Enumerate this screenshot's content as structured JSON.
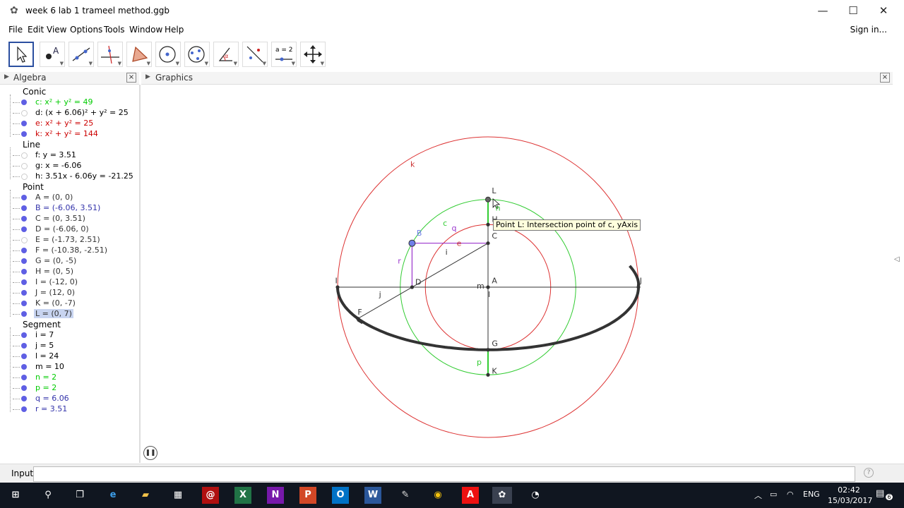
{
  "window": {
    "title": "week 6 lab 1 trameel method.ggb",
    "app_icon": "geogebra-icon"
  },
  "menu": {
    "items": [
      "File",
      "Edit",
      "View",
      "Options",
      "Tools",
      "Window",
      "Help"
    ],
    "signin": "Sign in..."
  },
  "toolbar": {
    "tools": [
      "move-tool",
      "point-tool",
      "line-tool",
      "perpendicular-tool",
      "polygon-tool",
      "circle-tool",
      "conic-tool",
      "angle-tool",
      "reflect-tool",
      "slider-tool",
      "move-graphics-tool"
    ],
    "slider_label": "a = 2"
  },
  "panels": {
    "algebra": "Algebra",
    "graphics": "Graphics"
  },
  "algebra": {
    "categories": [
      "Conic",
      "Line",
      "Point",
      "Segment"
    ],
    "conic": [
      {
        "text": "c: x² + y² = 49",
        "color": "#00cc00",
        "shown": true
      },
      {
        "text": "d: (x + 6.06)² + y² = 25",
        "color": "#000000",
        "shown": false
      },
      {
        "text": "e: x² + y² = 25",
        "color": "#cc0000",
        "shown": true
      },
      {
        "text": "k: x² + y² = 144",
        "color": "#cc0000",
        "shown": true
      }
    ],
    "line": [
      {
        "text": "f: y = 3.51",
        "color": "#000000",
        "shown": false
      },
      {
        "text": "g: x = -6.06",
        "color": "#000000",
        "shown": false
      },
      {
        "text": "h: 3.51x - 6.06y = -21.25",
        "color": "#000000",
        "shown": false
      }
    ],
    "point": [
      {
        "text": "A = (0, 0)",
        "color": "#333333",
        "shown": true
      },
      {
        "text": "B = (-6.06, 3.51)",
        "color": "#3333aa",
        "shown": true
      },
      {
        "text": "C = (0, 3.51)",
        "color": "#333333",
        "shown": true
      },
      {
        "text": "D = (-6.06, 0)",
        "color": "#333333",
        "shown": true
      },
      {
        "text": "E = (-1.73, 2.51)",
        "color": "#333333",
        "shown": false
      },
      {
        "text": "F = (-10.38, -2.51)",
        "color": "#333333",
        "shown": true
      },
      {
        "text": "G = (0, -5)",
        "color": "#333333",
        "shown": true
      },
      {
        "text": "H = (0, 5)",
        "color": "#333333",
        "shown": true
      },
      {
        "text": "I = (-12, 0)",
        "color": "#333333",
        "shown": true
      },
      {
        "text": "J = (12, 0)",
        "color": "#333333",
        "shown": true
      },
      {
        "text": "K = (0, -7)",
        "color": "#333333",
        "shown": true
      },
      {
        "text": "L = (0, 7)",
        "color": "#333333",
        "shown": true,
        "selected": true
      }
    ],
    "segment": [
      {
        "text": "i = 7",
        "color": "#000000",
        "shown": true
      },
      {
        "text": "j = 5",
        "color": "#000000",
        "shown": true
      },
      {
        "text": "l = 24",
        "color": "#000000",
        "shown": true
      },
      {
        "text": "m = 10",
        "color": "#000000",
        "shown": true
      },
      {
        "text": "n = 2",
        "color": "#00cc00",
        "shown": true
      },
      {
        "text": "p = 2",
        "color": "#00cc00",
        "shown": true
      },
      {
        "text": "q = 6.06",
        "color": "#3333aa",
        "shown": true
      },
      {
        "text": "r = 3.51",
        "color": "#3333aa",
        "shown": true
      }
    ]
  },
  "graphics": {
    "tooltip": "Point L: Intersection point of c, yAxis",
    "labels": [
      "k",
      "L",
      "H",
      "C",
      "c",
      "q",
      "e",
      "B",
      "i",
      "r",
      "I",
      "D",
      "j",
      "m",
      "A",
      "l",
      "J",
      "F",
      "G",
      "p",
      "K",
      "n"
    ],
    "colors": {
      "circle_k": "#dd3333",
      "circle_c": "#33cc33",
      "circle_e": "#dd3333",
      "segment_q": "#9933cc",
      "curve": "#333333"
    }
  },
  "input": {
    "label": "Input:",
    "value": ""
  },
  "taskbar": {
    "apps": [
      "windows-start-icon",
      "search-icon",
      "task-view-icon",
      "edge-icon",
      "explorer-icon",
      "store-icon",
      "acrobat-icon",
      "excel-icon",
      "onenote-icon",
      "powerpoint-icon",
      "outlook-icon",
      "word-icon",
      "paint-icon",
      "chrome-icon",
      "acrobat-reader-icon",
      "geogebra-icon",
      "clock-app-icon"
    ],
    "language": "ENG",
    "time": "02:42",
    "date": "15/03/2017",
    "notifications": "6"
  }
}
